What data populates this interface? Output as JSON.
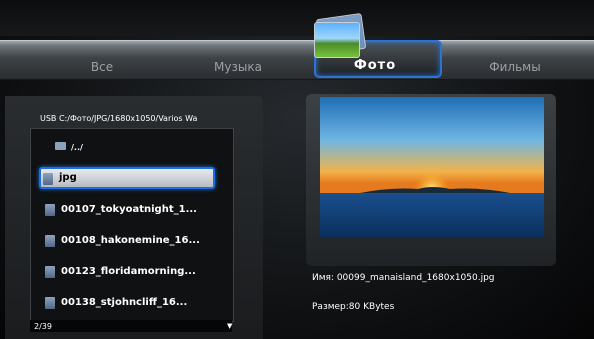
{
  "tabs": [
    {
      "label": "Все",
      "active": false
    },
    {
      "label": "Музыка",
      "active": false
    },
    {
      "label": "Фото",
      "active": true
    },
    {
      "label": "Фильмы",
      "active": false
    }
  ],
  "browser": {
    "path": "USB C:/Фото/JPG/1680x1050/Varios Wa",
    "parent": "/../",
    "items": [
      {
        "label": "jpg",
        "icon": "image-file-icon",
        "selected": true
      },
      {
        "label": "00107_tokyoatnight_1...",
        "icon": "image-file-icon",
        "selected": false
      },
      {
        "label": "00108_hakonemine_16...",
        "icon": "image-file-icon",
        "selected": false
      },
      {
        "label": "00123_floridamorning...",
        "icon": "image-file-icon",
        "selected": false
      },
      {
        "label": "00138_stjohncliff_16...",
        "icon": "image-file-icon",
        "selected": false
      }
    ],
    "counter": "2/39"
  },
  "preview": {
    "name": "Имя: 00099_manaisland_1680x1050.jpg",
    "size": "Размер:80 KBytes"
  },
  "colors": {
    "accent": "#2c73d4"
  }
}
